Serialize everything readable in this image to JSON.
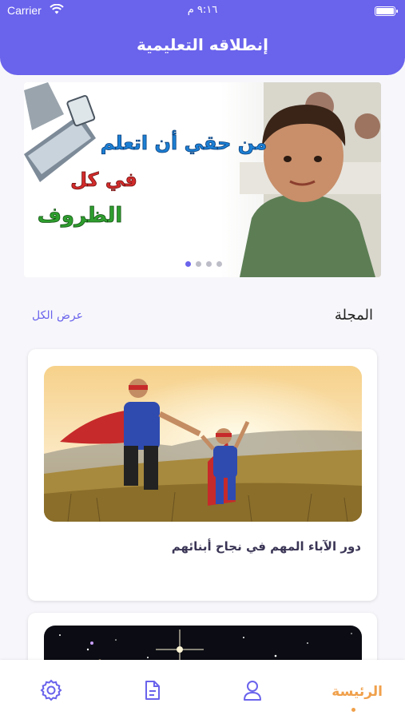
{
  "status_bar": {
    "carrier": "Carrier",
    "time": "٩:١٦ م"
  },
  "header": {
    "title": "إنطلاقه التعليمية"
  },
  "banner": {
    "line1": "من حقي أن اتعلم",
    "line2": "في كل",
    "line3": "الظروف",
    "page_count": 4,
    "active_index": 0
  },
  "magazine": {
    "section_title": "المجلة",
    "view_all": "عرض الكل"
  },
  "articles": [
    {
      "title": "دور الآباء المهم في نجاح أبنائهم"
    },
    {
      "title": ""
    }
  ],
  "tabbar": {
    "home_label": "الرئيسة",
    "icons": [
      "settings-icon",
      "document-icon",
      "profile-icon"
    ],
    "active_color": "#f0a04b",
    "inactive_color": "#6a63ec"
  },
  "colors": {
    "primary": "#6a63ec",
    "accent": "#f0a04b"
  }
}
